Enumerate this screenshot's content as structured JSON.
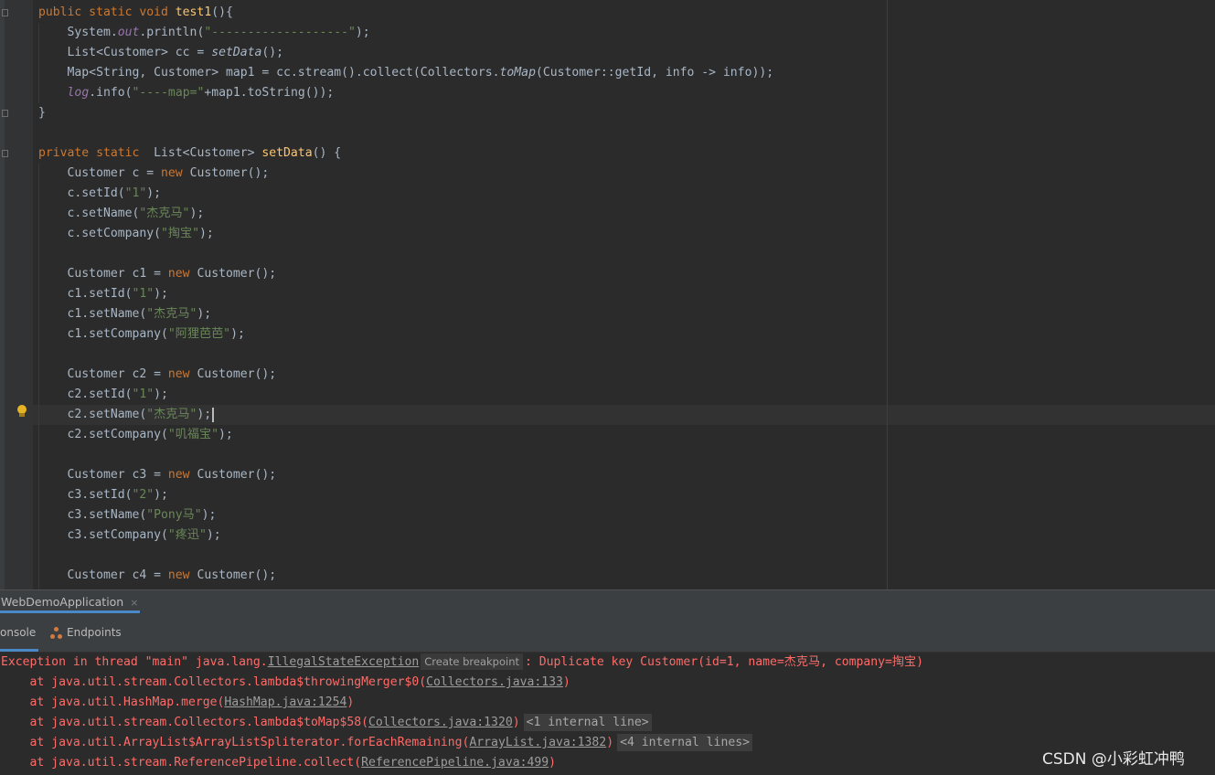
{
  "editor": {
    "lines": [
      [
        {
          "t": "public static void ",
          "c": "kw"
        },
        {
          "t": "test1",
          "c": "fn"
        },
        {
          "t": "(){",
          "c": ""
        }
      ],
      [
        {
          "t": "    System.",
          "c": ""
        },
        {
          "t": "out",
          "c": "pu"
        },
        {
          "t": ".println(",
          "c": ""
        },
        {
          "t": "\"-------------------\"",
          "c": "st"
        },
        {
          "t": ");",
          "c": ""
        }
      ],
      [
        {
          "t": "    List<Customer> cc = ",
          "c": ""
        },
        {
          "t": "setData",
          "c": "it"
        },
        {
          "t": "();",
          "c": ""
        }
      ],
      [
        {
          "t": "    Map<String, Customer> map1 = cc.stream().collect(Collectors.",
          "c": ""
        },
        {
          "t": "toMap",
          "c": "it"
        },
        {
          "t": "(Customer::getId, info -> info));",
          "c": ""
        }
      ],
      [
        {
          "t": "    ",
          "c": ""
        },
        {
          "t": "log",
          "c": "pu"
        },
        {
          "t": ".info(",
          "c": ""
        },
        {
          "t": "\"----map=\"",
          "c": "st"
        },
        {
          "t": "+map1.toString());",
          "c": ""
        }
      ],
      [
        {
          "t": "}",
          "c": ""
        }
      ],
      [],
      [
        {
          "t": "private static  ",
          "c": "kw"
        },
        {
          "t": "List<Customer> ",
          "c": ""
        },
        {
          "t": "setData",
          "c": "fn"
        },
        {
          "t": "() {",
          "c": ""
        }
      ],
      [
        {
          "t": "    Customer c = ",
          "c": ""
        },
        {
          "t": "new ",
          "c": "kw"
        },
        {
          "t": "Customer();",
          "c": ""
        }
      ],
      [
        {
          "t": "    c.setId(",
          "c": ""
        },
        {
          "t": "\"1\"",
          "c": "st"
        },
        {
          "t": ");",
          "c": ""
        }
      ],
      [
        {
          "t": "    c.setName(",
          "c": ""
        },
        {
          "t": "\"杰克马\"",
          "c": "st"
        },
        {
          "t": ");",
          "c": ""
        }
      ],
      [
        {
          "t": "    c.setCompany(",
          "c": ""
        },
        {
          "t": "\"掏宝\"",
          "c": "st"
        },
        {
          "t": ");",
          "c": ""
        }
      ],
      [],
      [
        {
          "t": "    Customer c1 = ",
          "c": ""
        },
        {
          "t": "new ",
          "c": "kw"
        },
        {
          "t": "Customer();",
          "c": ""
        }
      ],
      [
        {
          "t": "    c1.setId(",
          "c": ""
        },
        {
          "t": "\"1\"",
          "c": "st"
        },
        {
          "t": ");",
          "c": ""
        }
      ],
      [
        {
          "t": "    c1.setName(",
          "c": ""
        },
        {
          "t": "\"杰克马\"",
          "c": "st"
        },
        {
          "t": ");",
          "c": ""
        }
      ],
      [
        {
          "t": "    c1.setCompany(",
          "c": ""
        },
        {
          "t": "\"阿狸芭芭\"",
          "c": "st"
        },
        {
          "t": ");",
          "c": ""
        }
      ],
      [],
      [
        {
          "t": "    Customer c2 = ",
          "c": ""
        },
        {
          "t": "new ",
          "c": "kw"
        },
        {
          "t": "Customer();",
          "c": ""
        }
      ],
      [
        {
          "t": "    c2.setId(",
          "c": ""
        },
        {
          "t": "\"1\"",
          "c": "st"
        },
        {
          "t": ");",
          "c": ""
        }
      ],
      [
        {
          "t": "    c2.setName(",
          "c": ""
        },
        {
          "t": "\"杰克马\"",
          "c": "st"
        },
        {
          "t": ");",
          "c": ""
        },
        {
          "t": "",
          "c": "caret"
        }
      ],
      [
        {
          "t": "    c2.setCompany(",
          "c": ""
        },
        {
          "t": "\"叽福宝\"",
          "c": "st"
        },
        {
          "t": ");",
          "c": ""
        }
      ],
      [],
      [
        {
          "t": "    Customer c3 = ",
          "c": ""
        },
        {
          "t": "new ",
          "c": "kw"
        },
        {
          "t": "Customer();",
          "c": ""
        }
      ],
      [
        {
          "t": "    c3.setId(",
          "c": ""
        },
        {
          "t": "\"2\"",
          "c": "st"
        },
        {
          "t": ");",
          "c": ""
        }
      ],
      [
        {
          "t": "    c3.setName(",
          "c": ""
        },
        {
          "t": "\"Pony马\"",
          "c": "st"
        },
        {
          "t": ");",
          "c": ""
        }
      ],
      [
        {
          "t": "    c3.setCompany(",
          "c": ""
        },
        {
          "t": "\"疼迅\"",
          "c": "st"
        },
        {
          "t": ");",
          "c": ""
        }
      ],
      [],
      [
        {
          "t": "    Customer c4 = ",
          "c": ""
        },
        {
          "t": "new ",
          "c": "kw"
        },
        {
          "t": "Customer();",
          "c": ""
        }
      ]
    ]
  },
  "run_panel": {
    "tab_label": "WebDemoApplication",
    "close_glyph": "×",
    "console_tab": "onsole",
    "endpoints_tab": "Endpoints"
  },
  "console": {
    "lines": [
      [
        {
          "t": "Exception in thread \"main\" java.lang.",
          "c": ""
        },
        {
          "t": "IllegalStateException",
          "c": "link"
        },
        {
          "t": "Create breakpoint",
          "c": "chip"
        },
        {
          "t": ": Duplicate key Customer(id=1, name=杰克马, company=掏宝)",
          "c": ""
        }
      ],
      [
        {
          "t": "    at java.util.stream.Collectors.lambda$throwingMerger$0(",
          "c": ""
        },
        {
          "t": "Collectors.java:133",
          "c": "link"
        },
        {
          "t": ")",
          "c": ""
        }
      ],
      [
        {
          "t": "    at java.util.HashMap.merge(",
          "c": ""
        },
        {
          "t": "HashMap.java:1254",
          "c": "link"
        },
        {
          "t": ")",
          "c": ""
        }
      ],
      [
        {
          "t": "    at java.util.stream.Collectors.lambda$toMap$58(",
          "c": ""
        },
        {
          "t": "Collectors.java:1320",
          "c": "link"
        },
        {
          "t": ")",
          "c": ""
        },
        {
          "t": "<1 internal line>",
          "c": "fold-chip"
        }
      ],
      [
        {
          "t": "    at java.util.ArrayList$ArrayListSpliterator.forEachRemaining(",
          "c": ""
        },
        {
          "t": "ArrayList.java:1382",
          "c": "link"
        },
        {
          "t": ")",
          "c": ""
        },
        {
          "t": "<4 internal lines>",
          "c": "fold-chip"
        }
      ],
      [
        {
          "t": "    at java.util.stream.ReferencePipeline.collect(",
          "c": ""
        },
        {
          "t": "ReferencePipeline.java:499",
          "c": "link"
        },
        {
          "t": ")",
          "c": ""
        }
      ]
    ]
  },
  "watermark": "CSDN @小彩虹冲鸭"
}
